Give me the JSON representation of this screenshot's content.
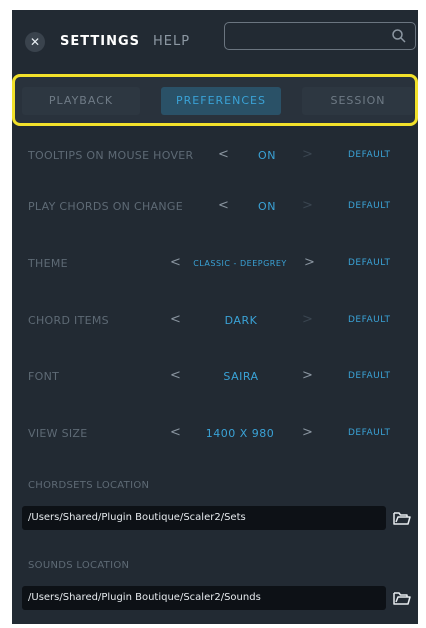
{
  "header": {
    "close_glyph": "✕",
    "tabs": [
      "SETTINGS",
      "HELP"
    ],
    "search_placeholder": ""
  },
  "subtabs": [
    "PLAYBACK",
    "PREFERENCES",
    "SESSION"
  ],
  "active_subtab": "PREFERENCES",
  "rows": [
    {
      "label": "TOOLTIPS ON MOUSE HOVER",
      "value": "ON",
      "default_label": "DEFAULT"
    },
    {
      "label": "PLAY CHORDS ON CHANGE",
      "value": "ON",
      "default_label": "DEFAULT"
    },
    {
      "label": "THEME",
      "value": "CLASSIC - DEEPGREY",
      "default_label": "DEFAULT"
    },
    {
      "label": "CHORD ITEMS",
      "value": "DARK",
      "default_label": "DEFAULT"
    },
    {
      "label": "FONT",
      "value": "SAIRA",
      "default_label": "DEFAULT"
    },
    {
      "label": "VIEW SIZE",
      "value": "1400 X 980",
      "default_label": "DEFAULT"
    }
  ],
  "arrows": {
    "left": "<",
    "right": ">"
  },
  "locations": [
    {
      "label": "CHORDSETS LOCATION",
      "path": "/Users/Shared/Plugin Boutique/Scaler2/Sets"
    },
    {
      "label": "SOUNDS LOCATION",
      "path": "/Users/Shared/Plugin Boutique/Scaler2/Sounds"
    }
  ],
  "colors": {
    "panel_bg": "#222a33",
    "accent": "#3aa2d6",
    "highlight_border": "#f2e12b",
    "field_bg": "#0d1116"
  },
  "icons": [
    "close-icon",
    "search-icon",
    "folder-icon"
  ]
}
